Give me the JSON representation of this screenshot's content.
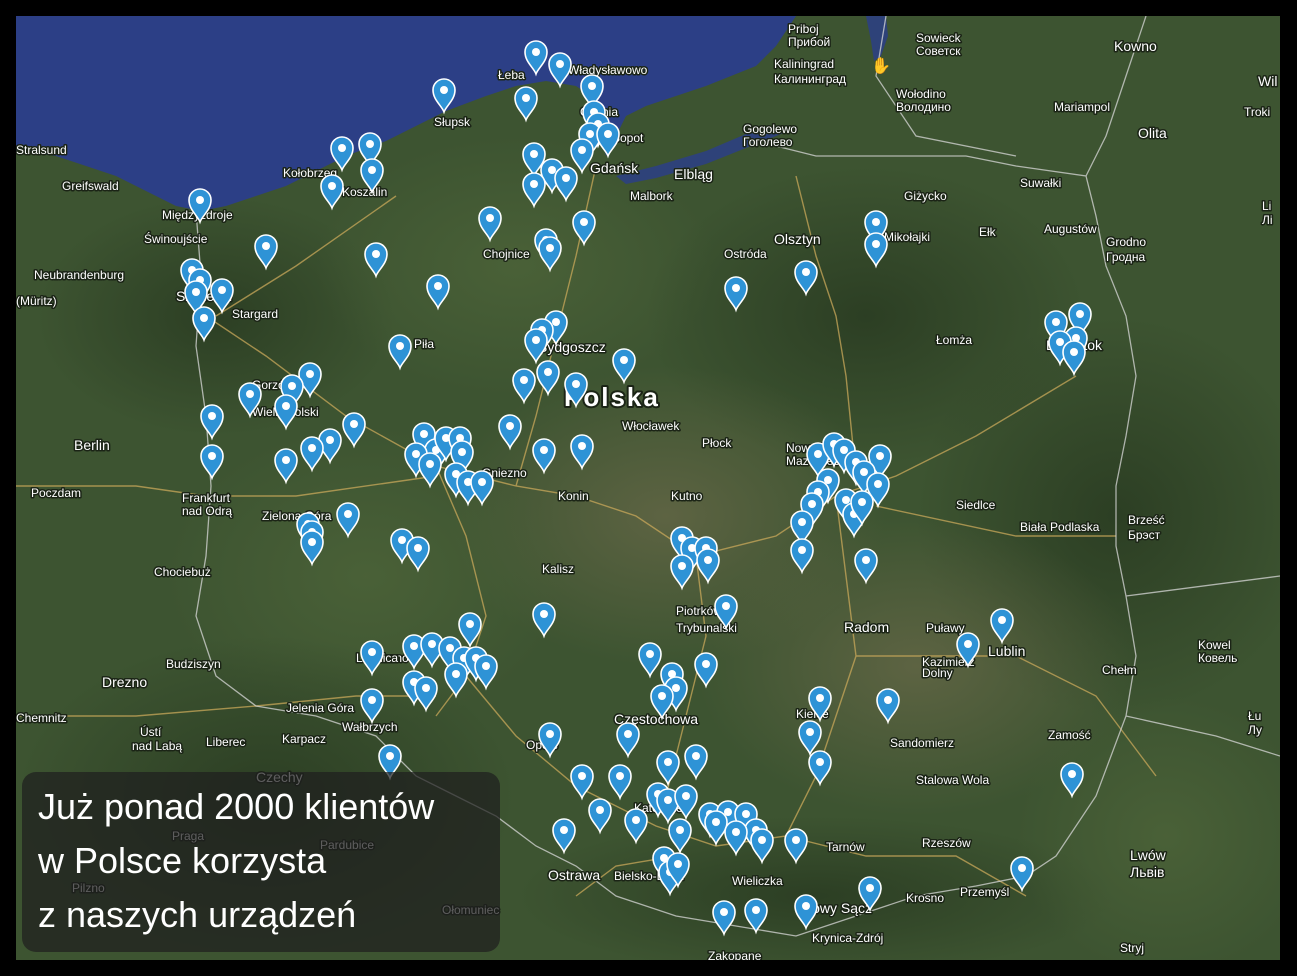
{
  "map": {
    "country_label": "Polska",
    "cities": [
      {
        "name": "Kowno",
        "style": "big"
      },
      {
        "name": "Wil",
        "style": "big"
      },
      {
        "name": "Sowieck\nСоветск"
      },
      {
        "name": "Kaliningrad\nКалининград"
      },
      {
        "name": "Priboj\nПрибой"
      },
      {
        "name": "Wołodino\nВолодино"
      },
      {
        "name": "Mariampol"
      },
      {
        "name": "Troki"
      },
      {
        "name": "Olita"
      },
      {
        "name": "Gogolewo\nГоголево"
      },
      {
        "name": "Władysławowo"
      },
      {
        "name": "Łeba"
      },
      {
        "name": "Słupsk"
      },
      {
        "name": "Gdynia"
      },
      {
        "name": "Sopot"
      },
      {
        "name": "Gdańsk",
        "style": "big"
      },
      {
        "name": "Elbląg"
      },
      {
        "name": "Malbork"
      },
      {
        "name": "Giżycko"
      },
      {
        "name": "Suwałki"
      },
      {
        "name": "Ełk"
      },
      {
        "name": "Augustów"
      },
      {
        "name": "Grodno\nГродна"
      },
      {
        "name": "Stralsund"
      },
      {
        "name": "Greifswald"
      },
      {
        "name": "Kołobrzeg"
      },
      {
        "name": "Koszalin"
      },
      {
        "name": "Międzyzdroje"
      },
      {
        "name": "Świnoujście"
      },
      {
        "name": "Chojnice"
      },
      {
        "name": "Olsztyn"
      },
      {
        "name": "Ostróda"
      },
      {
        "name": "Mikołajki"
      },
      {
        "name": "Neubrandenburg"
      },
      {
        "name": "(Müritz)"
      },
      {
        "name": "Szczecin",
        "style": "big"
      },
      {
        "name": "Stargard"
      },
      {
        "name": "Piła"
      },
      {
        "name": "Bydgoszcz",
        "style": "big"
      },
      {
        "name": "Łomża"
      },
      {
        "name": "Białystok",
        "style": "big"
      },
      {
        "name": "Gorzów Wielkopolski"
      },
      {
        "name": "Włocławek"
      },
      {
        "name": "Płock"
      },
      {
        "name": "Berlin",
        "style": "big"
      },
      {
        "name": "Gniezno"
      },
      {
        "name": "Nowy Dwór Mazowiecki"
      },
      {
        "name": "Poczdam"
      },
      {
        "name": "Frankfurt\nnad Odrą"
      },
      {
        "name": "Konin"
      },
      {
        "name": "Kutno"
      },
      {
        "name": "Siedlce"
      },
      {
        "name": "Biała Podlaska"
      },
      {
        "name": "Brześć\nБрэст"
      },
      {
        "name": "Zielona Góra"
      },
      {
        "name": "Kalisz"
      },
      {
        "name": "Chociebuż"
      },
      {
        "name": "Leszno"
      },
      {
        "name": "Piotrków\nTrybunalski"
      },
      {
        "name": "Radom"
      },
      {
        "name": "Puławy"
      },
      {
        "name": "Kazimierz\nDolny"
      },
      {
        "name": "Lublin",
        "style": "big"
      },
      {
        "name": "Kowel\nКовель"
      },
      {
        "name": "Budziszyn"
      },
      {
        "name": "Legnica"
      },
      {
        "name": "Chełm"
      },
      {
        "name": "Drezno",
        "style": "big"
      },
      {
        "name": "Jelenia Góra"
      },
      {
        "name": "Częstochowa",
        "style": "big"
      },
      {
        "name": "Kielce"
      },
      {
        "name": "Chemnitz"
      },
      {
        "name": "Wałbrzych"
      },
      {
        "name": "Ústí\nnad Labą"
      },
      {
        "name": "Liberec"
      },
      {
        "name": "Karpacz"
      },
      {
        "name": "Opole"
      },
      {
        "name": "Sandomierz"
      },
      {
        "name": "Zamość"
      },
      {
        "name": "Czechy",
        "style": "big"
      },
      {
        "name": "Stalowa Wola"
      },
      {
        "name": "Praga"
      },
      {
        "name": "Pardubice"
      },
      {
        "name": "Katowice"
      },
      {
        "name": "Tarnów"
      },
      {
        "name": "Rzeszów"
      },
      {
        "name": "Lwów\nЛьвів",
        "style": "big"
      },
      {
        "name": "Ostrawa",
        "style": "big"
      },
      {
        "name": "Bielsko-Biała"
      },
      {
        "name": "Wieliczka"
      },
      {
        "name": "Pilzno"
      },
      {
        "name": "Ołomuniec"
      },
      {
        "name": "Nowy Sącz"
      },
      {
        "name": "Krosno"
      },
      {
        "name": "Przemyśl"
      },
      {
        "name": "Krynica-Zdrój"
      },
      {
        "name": "Zakopane"
      },
      {
        "name": "Stryj\nСтрий"
      },
      {
        "name": "Łu\nЛу"
      },
      {
        "name": "Li\nЛі"
      }
    ]
  },
  "caption": {
    "line1": "Już ponad 2000 klientów",
    "line2": "w Polsce korzysta",
    "line3": "z naszych urządzeń"
  },
  "colors": {
    "pin": "#2e93d6",
    "sea": "#2c3f86",
    "land": "#3c5230",
    "road": "#c9a85a",
    "border": "#cfcfcf"
  }
}
